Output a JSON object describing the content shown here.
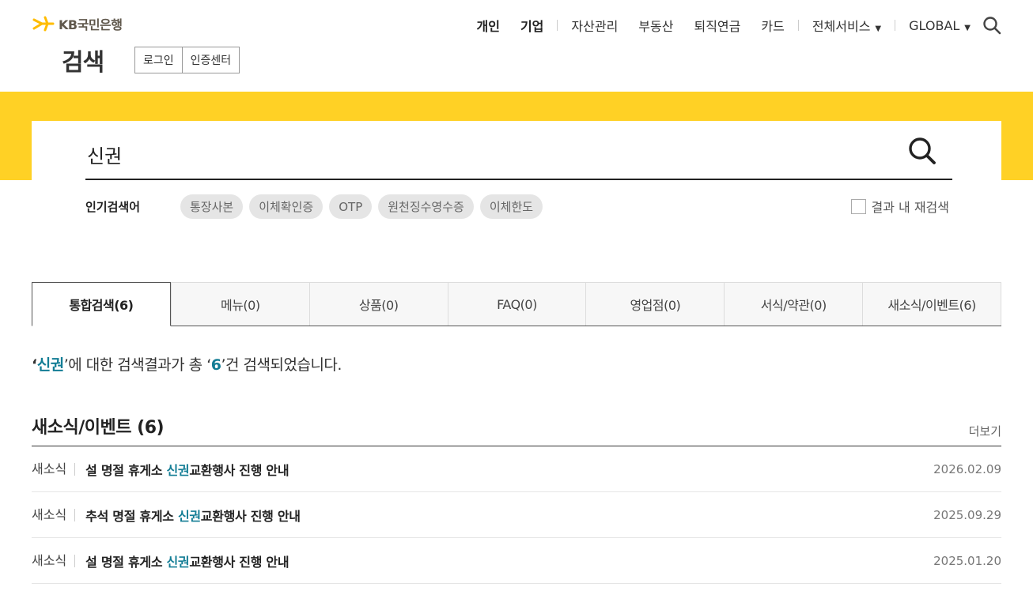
{
  "brand": {
    "name": "KB국민은행",
    "star_color": "#ffbc00",
    "accent": "#ffd125",
    "highlight": "#137d95"
  },
  "header": {
    "page_title": "검색",
    "auth": {
      "login": "로그인",
      "cert_center": "인증센터"
    },
    "gnb": {
      "personal": "개인",
      "corporate": "기업",
      "asset": "자산관리",
      "realestate": "부동산",
      "pension": "퇴직연금",
      "card": "카드",
      "all_services": "전체서비스",
      "global": "GLOBAL"
    }
  },
  "search": {
    "value": "신권",
    "popular_label": "인기검색어",
    "popular": [
      "통장사본",
      "이체확인증",
      "OTP",
      "원천징수영수증",
      "이체한도"
    ],
    "research_label": "결과 내 재검색",
    "research_checked": false
  },
  "tabs": [
    "통합검색(6)",
    "메뉴(0)",
    "상품(0)",
    "FAQ(0)",
    "영업점(0)",
    "서식/약관(0)",
    "새소식/이벤트(6)"
  ],
  "active_tab": 0,
  "summary": {
    "open_quote": "‘",
    "keyword": "신권",
    "mid": "’에 대한 검색결과가 총 ‘",
    "count": "6",
    "tail": "’건 검색되었습니다."
  },
  "section": {
    "title": "새소식/이벤트 (6)",
    "more": "더보기",
    "items": [
      {
        "category": "새소식",
        "before": "설 명절 휴게소 ",
        "keyword": "신권",
        "after": "교환행사 진행 안내",
        "date": "2026.02.09"
      },
      {
        "category": "새소식",
        "before": "추석 명절 휴게소 ",
        "keyword": "신권",
        "after": "교환행사 진행 안내",
        "date": "2025.09.29"
      },
      {
        "category": "새소식",
        "before": "설 명절 휴게소 ",
        "keyword": "신권",
        "after": "교환행사 진행 안내",
        "date": "2025.01.20"
      }
    ]
  }
}
